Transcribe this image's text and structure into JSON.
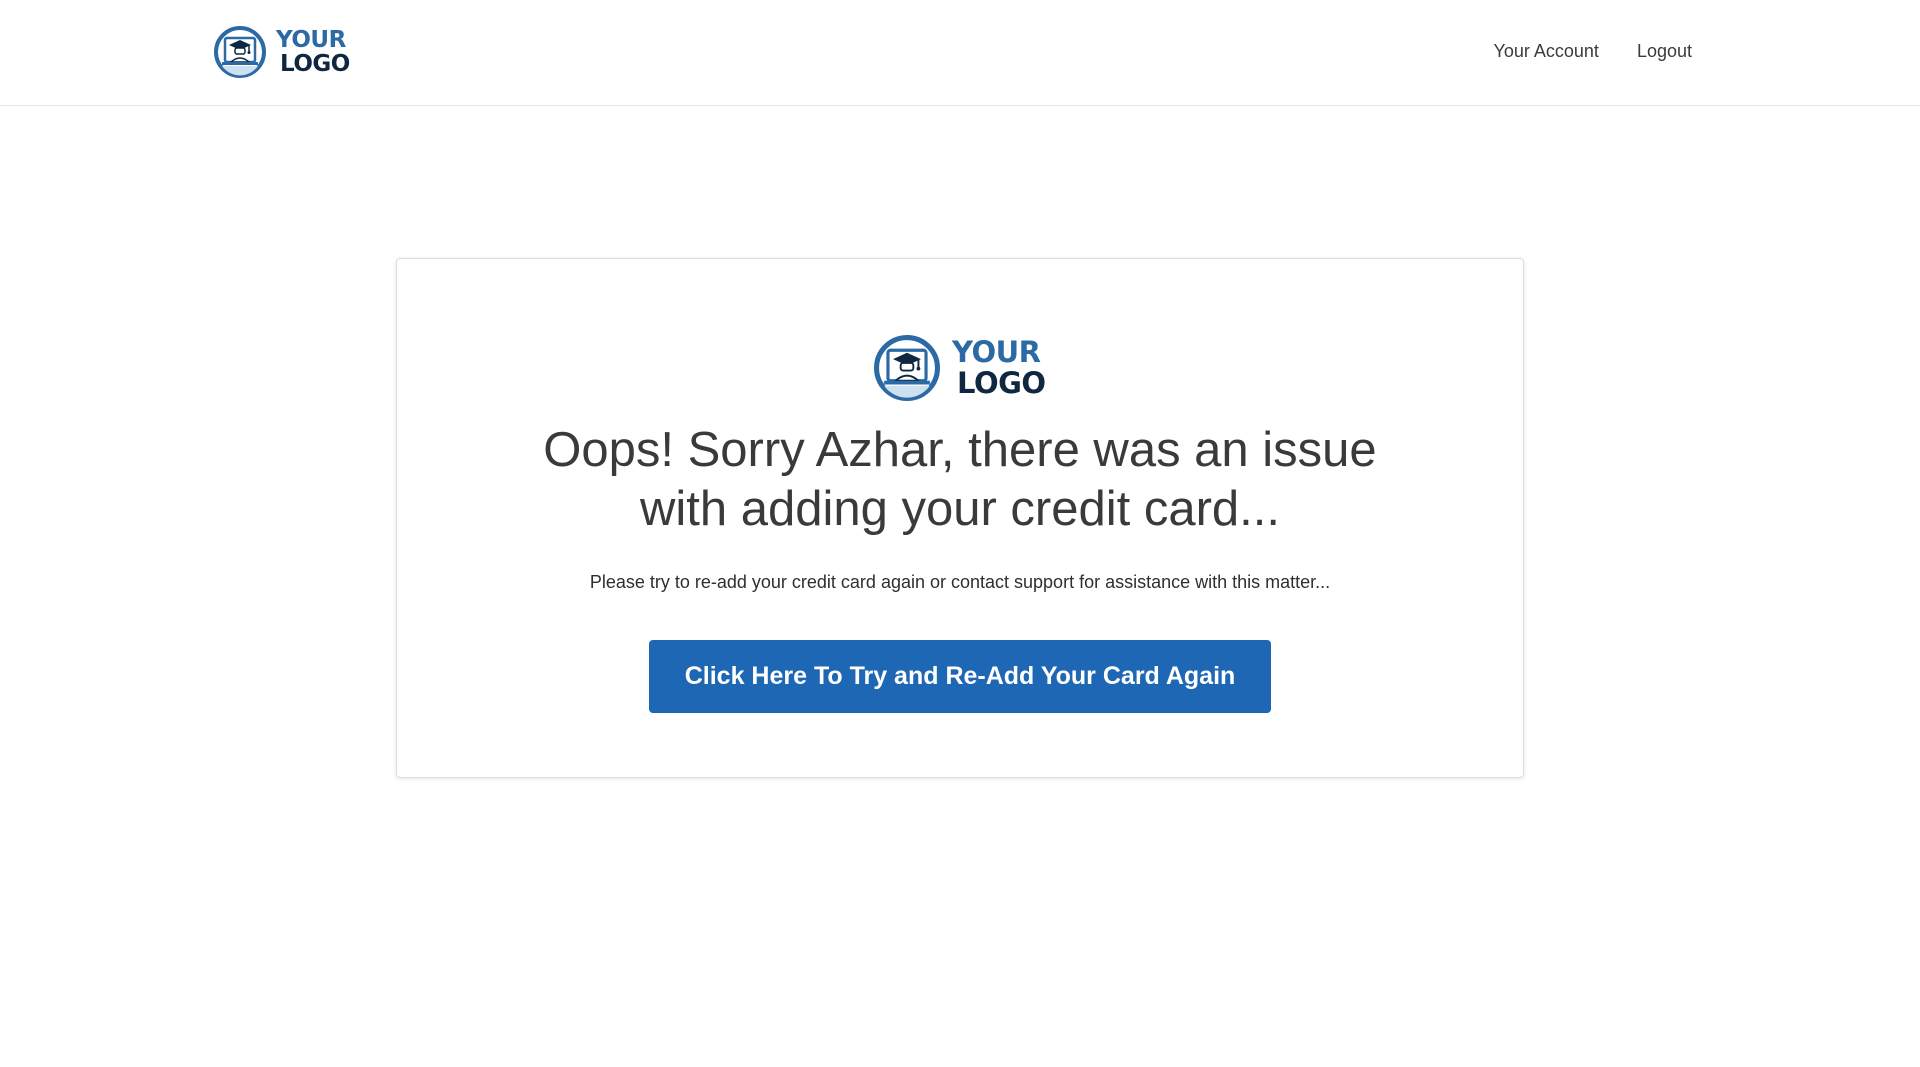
{
  "header": {
    "logo_line1": "YOUR",
    "logo_line2": "LOGO",
    "nav": {
      "account_label": "Your Account",
      "logout_label": "Logout"
    }
  },
  "card": {
    "logo_line1": "YOUR",
    "logo_line2": "LOGO",
    "headline_line1": "Oops! Sorry Azhar, there was an issue",
    "headline_line2": "with adding your credit card...",
    "subtext": "Please try to re-add your credit card again or contact support for assistance with this matter...",
    "cta_label": "Click Here To Try and Re-Add Your Card Again"
  },
  "colors": {
    "brand_blue": "#1d67b4",
    "logo_blue": "#2c6aa6",
    "logo_dark": "#0f2740"
  },
  "icons": {
    "logo_mark": "graduate-badge-icon"
  }
}
